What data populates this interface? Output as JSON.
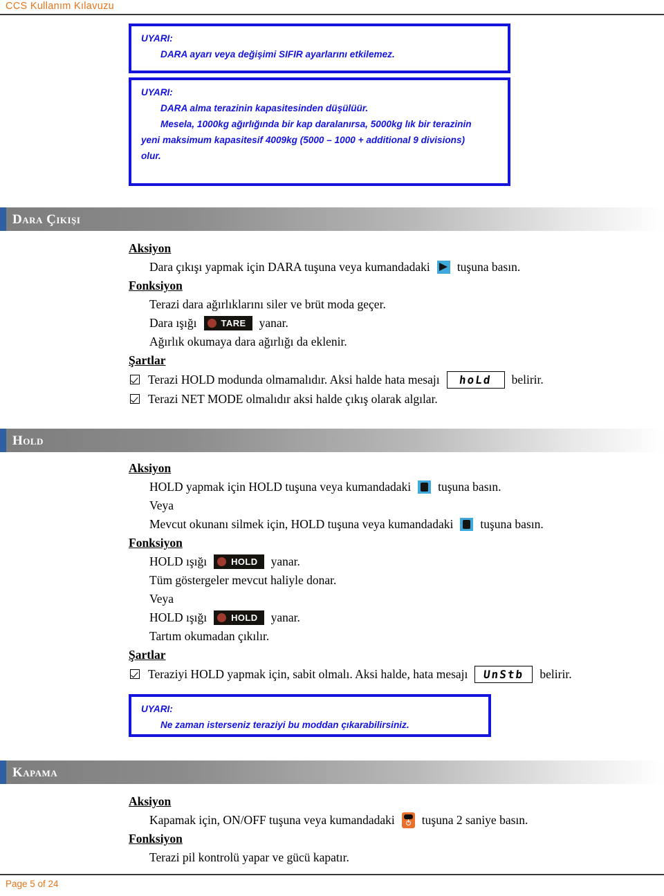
{
  "header": {
    "title": "CCS Kullanım Kılavuzu"
  },
  "footer": {
    "page_label": "Page 5 of 24"
  },
  "colors": {
    "accent_orange": "#E2761B",
    "warning_blue": "#1414DC",
    "section_accent_blue": "#2E5FA3",
    "key_blue": "#3FA9DC",
    "key_orange": "#E8702A",
    "lamp_red": "#A03A2E",
    "lamp_background": "#17140F"
  },
  "warnings": {
    "label": "UYARI:",
    "top_box": {
      "title": "UYARI:",
      "lines": [
        "DARA ayarı veya değişimi SIFIR ayarlarını etkilemez."
      ]
    },
    "second_box": {
      "title": "UYARI:",
      "lines": [
        "DARA alma terazinin kapasitesinden düşülüür.",
        "Mesela, 1000kg ağırlığında bir kap daralanırsa, 5000kg lık bir terazinin",
        "yeni maksimum kapasitesif 4009kg (5000 – 1000 + additional 9 divisions)",
        "olur."
      ]
    },
    "hold_box": {
      "title": "UYARI:",
      "lines": [
        "Ne zaman isterseniz teraziyi bu moddan çıkarabilirsiniz."
      ]
    }
  },
  "sections": {
    "dara_cikisi": {
      "bar_label": "Dara Çıkışı",
      "aksiyon_label": "Aksiyon",
      "aksiyon_text_before": "Dara çıkışı yapmak için DARA tuşuna veya kumandadaki",
      "aksiyon_text_after": "tuşuna basın.",
      "aksiyon_key_icon": "remote-arrow-key-icon",
      "fonksiyon_label": "Fonksiyon",
      "fonksiyon_line1": "Terazi dara ağırlıklarını siler ve brüt moda geçer.",
      "fonksiyon_line2_before": "Dara ışığı",
      "fonksiyon_line2_lamp": "TARE",
      "fonksiyon_line2_after": "yanar.",
      "fonksiyon_line3": "Ağırlık okumaya dara ağırlığı da eklenir.",
      "sartlar_label": "Şartlar",
      "conditions": [
        {
          "text_before": "Terazi HOLD modunda olmamalıdır. Aksi halde hata mesajı",
          "lcd": "hoLd",
          "text_after": "belirir."
        },
        {
          "text_before": "Terazi NET MODE olmalıdır aksi halde çıkış olarak algılar.",
          "lcd": "",
          "text_after": ""
        }
      ]
    },
    "hold": {
      "bar_label": "Hold",
      "aksiyon_label": "Aksiyon",
      "aksiyon_line1_before": "HOLD yapmak için HOLD tuşuna veya kumandadaki",
      "aksiyon_line1_after": "tuşuna basın.",
      "veya_label": "Veya",
      "aksiyon_line2_before": "Mevcut okunanı silmek için, HOLD tuşuna veya kumandadaki",
      "aksiyon_line2_after": "tuşuna basın.",
      "aksiyon_key_icon": "remote-hold-key-icon",
      "fonksiyon_label": "Fonksiyon",
      "fonksiyon_line1_before": "HOLD ışığı",
      "fonksiyon_line1_lamp": "HOLD",
      "fonksiyon_line1_after": "yanar.",
      "fonksiyon_line2": "Tüm göstergeler mevcut haliyle donar.",
      "fonksiyon_veya": "Veya",
      "fonksiyon_line3_before": "HOLD ışığı",
      "fonksiyon_line3_lamp": "HOLD",
      "fonksiyon_line3_after": "yanar.",
      "fonksiyon_line4": "Tartım okumadan çıkılır.",
      "sartlar_label": "Şartlar",
      "condition": {
        "text_before": "Teraziyi HOLD yapmak için, sabit olmalı. Aksi halde, hata mesajı",
        "lcd": "UnStb",
        "text_after": "belirir."
      }
    },
    "kapama": {
      "bar_label": "Kapama",
      "aksiyon_label": "Aksiyon",
      "aksiyon_text_before": "Kapamak için, ON/OFF tuşuna veya kumandadaki",
      "aksiyon_text_after": "tuşuna 2 saniye basın.",
      "aksiyon_key_icon": "remote-power-key-icon",
      "fonksiyon_label": "Fonksiyon",
      "fonksiyon_line1": "Terazi pil kontrolü yapar ve gücü kapatır."
    }
  }
}
